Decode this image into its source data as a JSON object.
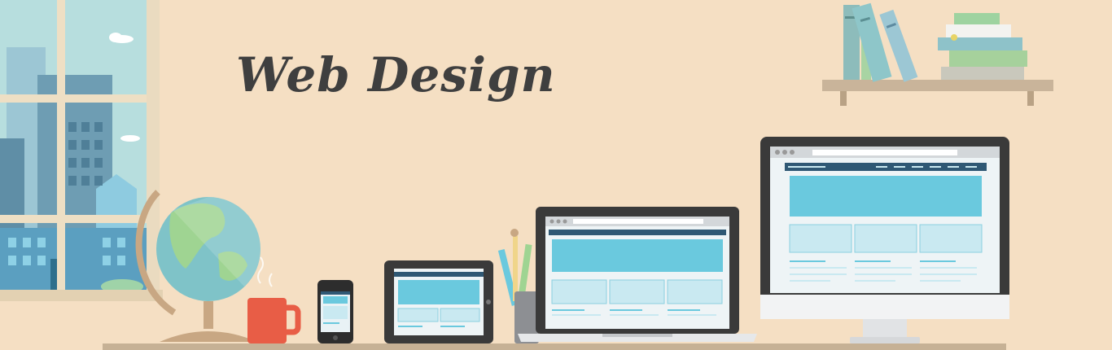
{
  "banner": {
    "title": "Web Design"
  },
  "colors": {
    "background": "#f5dfc3",
    "screen_accent": "#6ac9de",
    "screen_light": "#c9e9f1",
    "navbar": "#2f5874",
    "title_text": "#3f3f3f"
  },
  "illustration_items": [
    "window-with-city-view",
    "desk-globe",
    "coffee-mug",
    "smartphone",
    "tablet",
    "pencil-cup",
    "laptop",
    "desktop-monitor",
    "bookshelf-with-books"
  ]
}
